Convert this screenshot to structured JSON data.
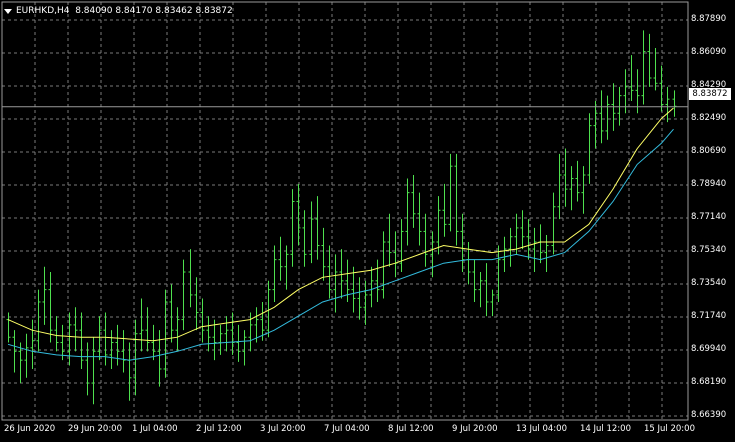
{
  "header": {
    "symbol": "EURHKD,H4",
    "open": "8.84090",
    "high": "8.84170",
    "low": "8.83462",
    "close": "8.83872"
  },
  "price_axis": {
    "labels": [
      "8.87890",
      "8.86090",
      "8.84290",
      "8.82490",
      "8.80690",
      "8.78940",
      "8.77140",
      "8.75340",
      "8.73540",
      "8.71740",
      "8.69940",
      "8.68190",
      "8.66390"
    ],
    "current_price": "8.83872"
  },
  "time_axis": {
    "labels": [
      "26 Jun 2020",
      "29 Jun 20:00",
      "1 Jul 04:00",
      "2 Jul 12:00",
      "3 Jul 20:00",
      "7 Jul 04:00",
      "8 Jul 12:00",
      "9 Jul 20:00",
      "13 Jul 04:00",
      "14 Jul 12:00",
      "15 Jul 20:00"
    ]
  },
  "colors": {
    "background": "#000000",
    "grid": "#7a7a7a",
    "bars": "#4ee04e",
    "ma_fast": "#ffff66",
    "ma_slow": "#33bbdd",
    "text": "#ffffff"
  },
  "chart_data": {
    "type": "ohlc",
    "ylim": [
      8.6639,
      8.8879
    ],
    "grid": true,
    "bars": [
      [
        8.718,
        8.722,
        8.705,
        8.708
      ],
      [
        8.708,
        8.712,
        8.688,
        8.7
      ],
      [
        8.7,
        8.705,
        8.682,
        8.695
      ],
      [
        8.695,
        8.71,
        8.685,
        8.702
      ],
      [
        8.702,
        8.718,
        8.69,
        8.706
      ],
      [
        8.706,
        8.735,
        8.7,
        8.728
      ],
      [
        8.728,
        8.748,
        8.715,
        8.735
      ],
      [
        8.735,
        8.745,
        8.705,
        8.712
      ],
      [
        8.712,
        8.72,
        8.7,
        8.705
      ],
      [
        8.705,
        8.715,
        8.695,
        8.7
      ],
      [
        8.7,
        8.722,
        8.692,
        8.715
      ],
      [
        8.715,
        8.725,
        8.7,
        8.712
      ],
      [
        8.712,
        8.722,
        8.69,
        8.695
      ],
      [
        8.695,
        8.705,
        8.675,
        8.682
      ],
      [
        8.682,
        8.708,
        8.67,
        8.7
      ],
      [
        8.7,
        8.72,
        8.695,
        8.712
      ],
      [
        8.712,
        8.722,
        8.692,
        8.698
      ],
      [
        8.698,
        8.712,
        8.69,
        8.705
      ],
      [
        8.705,
        8.715,
        8.692,
        8.7
      ],
      [
        8.7,
        8.712,
        8.688,
        8.695
      ],
      [
        8.695,
        8.705,
        8.672,
        8.685
      ],
      [
        8.685,
        8.718,
        8.675,
        8.71
      ],
      [
        8.71,
        8.73,
        8.7,
        8.712
      ],
      [
        8.712,
        8.725,
        8.7,
        8.705
      ],
      [
        8.705,
        8.715,
        8.695,
        8.7
      ],
      [
        8.7,
        8.712,
        8.68,
        8.69
      ],
      [
        8.69,
        8.735,
        8.685,
        8.728
      ],
      [
        8.728,
        8.738,
        8.705,
        8.712
      ],
      [
        8.712,
        8.725,
        8.7,
        8.718
      ],
      [
        8.718,
        8.752,
        8.712,
        8.745
      ],
      [
        8.745,
        8.758,
        8.725,
        8.732
      ],
      [
        8.732,
        8.742,
        8.712,
        8.722
      ],
      [
        8.722,
        8.73,
        8.705,
        8.712
      ],
      [
        8.712,
        8.72,
        8.7,
        8.708
      ],
      [
        8.708,
        8.718,
        8.695,
        8.705
      ],
      [
        8.705,
        8.715,
        8.698,
        8.71
      ],
      [
        8.71,
        8.72,
        8.7,
        8.712
      ],
      [
        8.712,
        8.722,
        8.698,
        8.705
      ],
      [
        8.705,
        8.715,
        8.694,
        8.7
      ],
      [
        8.7,
        8.712,
        8.692,
        8.708
      ],
      [
        8.708,
        8.722,
        8.7,
        8.715
      ],
      [
        8.715,
        8.725,
        8.705,
        8.718
      ],
      [
        8.718,
        8.728,
        8.706,
        8.712
      ],
      [
        8.712,
        8.74,
        8.708,
        8.735
      ],
      [
        8.735,
        8.76,
        8.728,
        8.752
      ],
      [
        8.752,
        8.765,
        8.74,
        8.748
      ],
      [
        8.748,
        8.76,
        8.735,
        8.755
      ],
      [
        8.755,
        8.792,
        8.748,
        8.785
      ],
      [
        8.785,
        8.795,
        8.76,
        8.77
      ],
      [
        8.77,
        8.78,
        8.748,
        8.755
      ],
      [
        8.755,
        8.785,
        8.75,
        8.775
      ],
      [
        8.775,
        8.788,
        8.752,
        8.76
      ],
      [
        8.76,
        8.77,
        8.74,
        8.748
      ],
      [
        8.748,
        8.76,
        8.73,
        8.735
      ],
      [
        8.735,
        8.755,
        8.722,
        8.745
      ],
      [
        8.745,
        8.758,
        8.73,
        8.74
      ],
      [
        8.74,
        8.752,
        8.728,
        8.735
      ],
      [
        8.735,
        8.748,
        8.722,
        8.73
      ],
      [
        8.73,
        8.742,
        8.718,
        8.725
      ],
      [
        8.725,
        8.74,
        8.715,
        8.732
      ],
      [
        8.732,
        8.748,
        8.725,
        8.74
      ],
      [
        8.74,
        8.752,
        8.728,
        8.735
      ],
      [
        8.735,
        8.768,
        8.73,
        8.762
      ],
      [
        8.762,
        8.778,
        8.748,
        8.756
      ],
      [
        8.756,
        8.768,
        8.742,
        8.75
      ],
      [
        8.75,
        8.775,
        8.745,
        8.768
      ],
      [
        8.768,
        8.798,
        8.76,
        8.79
      ],
      [
        8.79,
        8.8,
        8.77,
        8.778
      ],
      [
        8.778,
        8.79,
        8.76,
        8.768
      ],
      [
        8.768,
        8.778,
        8.748,
        8.755
      ],
      [
        8.755,
        8.768,
        8.742,
        8.762
      ],
      [
        8.762,
        8.788,
        8.755,
        8.78
      ],
      [
        8.78,
        8.795,
        8.765,
        8.772
      ],
      [
        8.772,
        8.812,
        8.768,
        8.805
      ],
      [
        8.805,
        8.812,
        8.76,
        8.768
      ],
      [
        8.768,
        8.778,
        8.745,
        8.752
      ],
      [
        8.752,
        8.762,
        8.738,
        8.745
      ],
      [
        8.745,
        8.752,
        8.728,
        8.735
      ],
      [
        8.735,
        8.745,
        8.725,
        8.74
      ],
      [
        8.74,
        8.75,
        8.72,
        8.728
      ],
      [
        8.728,
        8.735,
        8.72,
        8.732
      ],
      [
        8.732,
        8.76,
        8.728,
        8.752
      ],
      [
        8.752,
        8.765,
        8.745,
        8.758
      ],
      [
        8.758,
        8.77,
        8.748,
        8.765
      ],
      [
        8.765,
        8.778,
        8.755,
        8.77
      ],
      [
        8.77,
        8.78,
        8.758,
        8.765
      ],
      [
        8.765,
        8.775,
        8.752,
        8.758
      ],
      [
        8.758,
        8.77,
        8.745,
        8.762
      ],
      [
        8.762,
        8.772,
        8.75,
        8.756
      ],
      [
        8.756,
        8.766,
        8.745,
        8.76
      ],
      [
        8.76,
        8.79,
        8.755,
        8.782
      ],
      [
        8.782,
        8.812,
        8.775,
        8.8
      ],
      [
        8.8,
        8.815,
        8.782,
        8.792
      ],
      [
        8.792,
        8.805,
        8.78,
        8.798
      ],
      [
        8.798,
        8.808,
        8.785,
        8.79
      ],
      [
        8.79,
        8.805,
        8.778,
        8.8
      ],
      [
        8.8,
        8.835,
        8.795,
        8.828
      ],
      [
        8.828,
        8.842,
        8.815,
        8.835
      ],
      [
        8.835,
        8.848,
        8.818,
        8.825
      ],
      [
        8.825,
        8.845,
        8.82,
        8.84
      ],
      [
        8.84,
        8.852,
        8.825,
        8.835
      ],
      [
        8.835,
        8.85,
        8.828,
        8.845
      ],
      [
        8.845,
        8.86,
        8.835,
        8.85
      ],
      [
        8.85,
        8.868,
        8.842,
        8.848
      ],
      [
        8.848,
        8.86,
        8.835,
        8.845
      ],
      [
        8.845,
        8.882,
        8.84,
        8.87
      ],
      [
        8.87,
        8.88,
        8.85,
        8.855
      ],
      [
        8.855,
        8.872,
        8.848,
        8.852
      ],
      [
        8.852,
        8.862,
        8.836,
        8.84
      ],
      [
        8.84,
        8.85,
        8.83,
        8.843
      ],
      [
        8.843,
        8.848,
        8.833,
        8.839
      ]
    ],
    "ma_fast": [
      [
        0,
        8.718
      ],
      [
        4,
        8.712
      ],
      [
        8,
        8.709
      ],
      [
        12,
        8.708
      ],
      [
        16,
        8.708
      ],
      [
        20,
        8.707
      ],
      [
        24,
        8.706
      ],
      [
        28,
        8.708
      ],
      [
        32,
        8.714
      ],
      [
        36,
        8.716
      ],
      [
        40,
        8.718
      ],
      [
        44,
        8.725
      ],
      [
        48,
        8.735
      ],
      [
        52,
        8.742
      ],
      [
        56,
        8.744
      ],
      [
        60,
        8.746
      ],
      [
        64,
        8.75
      ],
      [
        68,
        8.755
      ],
      [
        72,
        8.76
      ],
      [
        76,
        8.758
      ],
      [
        80,
        8.756
      ],
      [
        84,
        8.758
      ],
      [
        88,
        8.762
      ],
      [
        92,
        8.762
      ],
      [
        96,
        8.772
      ],
      [
        100,
        8.792
      ],
      [
        104,
        8.815
      ],
      [
        108,
        8.832
      ],
      [
        110,
        8.838
      ]
    ],
    "ma_slow": [
      [
        0,
        8.704
      ],
      [
        4,
        8.7
      ],
      [
        8,
        8.698
      ],
      [
        12,
        8.697
      ],
      [
        16,
        8.697
      ],
      [
        20,
        8.695
      ],
      [
        24,
        8.697
      ],
      [
        28,
        8.7
      ],
      [
        32,
        8.704
      ],
      [
        36,
        8.705
      ],
      [
        40,
        8.706
      ],
      [
        44,
        8.712
      ],
      [
        48,
        8.72
      ],
      [
        52,
        8.728
      ],
      [
        56,
        8.732
      ],
      [
        60,
        8.735
      ],
      [
        64,
        8.74
      ],
      [
        68,
        8.745
      ],
      [
        72,
        8.75
      ],
      [
        76,
        8.752
      ],
      [
        80,
        8.752
      ],
      [
        84,
        8.755
      ],
      [
        88,
        8.752
      ],
      [
        92,
        8.756
      ],
      [
        96,
        8.768
      ],
      [
        100,
        8.785
      ],
      [
        104,
        8.806
      ],
      [
        108,
        8.818
      ],
      [
        110,
        8.826
      ]
    ]
  }
}
